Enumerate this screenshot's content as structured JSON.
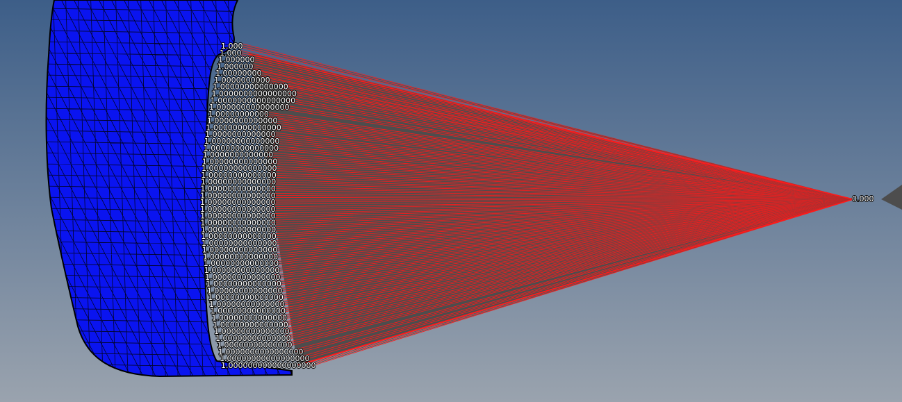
{
  "viewport": {
    "background_top": "#3d5e88",
    "background_bottom": "#9aa3ae",
    "mesh_fill": "#0a14f0",
    "mesh_edge": "#000000",
    "rbe_spoke_color": "#ff1a1a",
    "rbe_fill_color": "#4d4d4d",
    "label_color": "#ffffff",
    "center_node_label": "0.000",
    "node_weight_labels": [
      "1.000",
      "1.000",
      "1.000000",
      "1.000000",
      "1.00000000",
      "1.0000000000",
      "1.00000000000000",
      "1.0000000000000000",
      "1.0000000000000000",
      "1.000000000000000",
      "1.00000000000",
      "1.0000000000000",
      "1.00000000000000",
      "1.0000000000000",
      "1.00000000000000",
      "1.00000000000000",
      "1.0000000000000",
      "1.00000000000000",
      "1.00000000000000",
      "1.00000000000000",
      "1.00000000000000",
      "1.00000000000000",
      "1.00000000000000",
      "1.00000000000000",
      "1.00000000000000",
      "1.00000000000000",
      "1.00000000000000",
      "1.00000000000000",
      "1.00000000000000",
      "1.00000000000000",
      "1.00000000000000",
      "1.00000000000000",
      "1.00000000000000",
      "1.00000000000000",
      "1.00000000000000",
      "1.00000000000000",
      "1.00000000000000",
      "1.00000000000000",
      "1.00000000000000",
      "1.00000000000000",
      "1.00000000000000",
      "1.00000000000000",
      "1.00000000000000",
      "1.00000000000000",
      "1.00000000000000",
      "1.0000000000000000",
      "1.00000000000000000",
      "1.000000000000000000"
    ]
  }
}
